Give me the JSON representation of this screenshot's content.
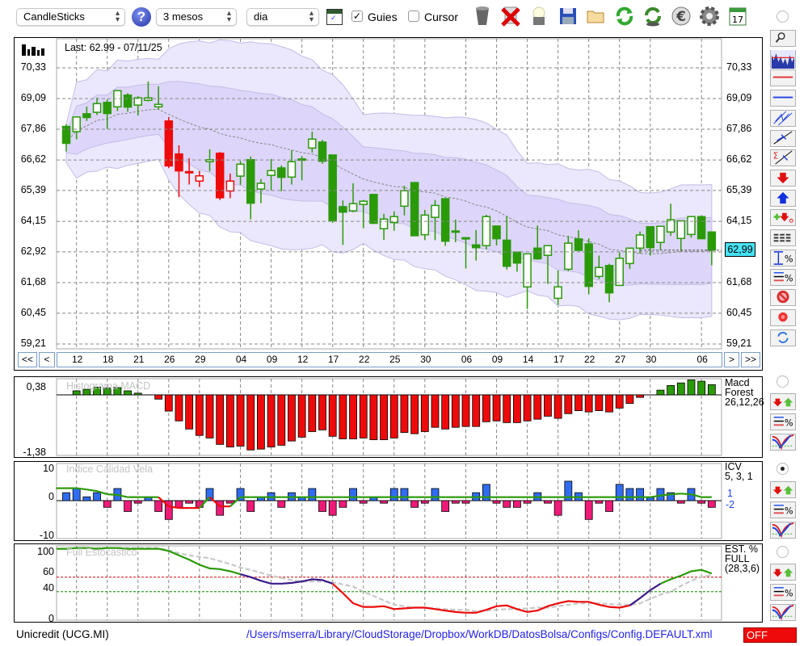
{
  "toolbar": {
    "chart_type": "CandleSticks",
    "period": "3 mesos",
    "interval": "dia",
    "guides_label": "Guies",
    "guides_checked": true,
    "cursor_label": "Cursor",
    "cursor_checked": false,
    "check_mark": "✓",
    "icons": [
      "trash-icon",
      "delete-icon",
      "lamp-icon",
      "save-icon",
      "folder-icon",
      "refresh-icon",
      "dollar-refresh-icon",
      "euro-icon",
      "gear-icon",
      "calendar-icon"
    ],
    "calendar_day": "17"
  },
  "main": {
    "last_text": "Last: 62.99 - 07/11/25",
    "price_label": "62,99",
    "last_price": 62.99,
    "y_ticks": [
      {
        "label": "70,33",
        "v": 70.33
      },
      {
        "label": "69,09",
        "v": 69.09
      },
      {
        "label": "67,86",
        "v": 67.86
      },
      {
        "label": "66,62",
        "v": 66.62
      },
      {
        "label": "65,39",
        "v": 65.39
      },
      {
        "label": "64,15",
        "v": 64.15
      },
      {
        "label": "62,92",
        "v": 62.92
      },
      {
        "label": "61,68",
        "v": 61.68
      },
      {
        "label": "60,45",
        "v": 60.45
      },
      {
        "label": "59,21",
        "v": 59.21
      }
    ],
    "ylim": [
      59.21,
      70.33
    ],
    "nav": {
      "first": "<<",
      "prev": "<",
      "next": ">",
      "last": ">>"
    },
    "dates": [
      {
        "label": "12",
        "i": 1
      },
      {
        "label": "18",
        "i": 4
      },
      {
        "label": "21",
        "i": 7
      },
      {
        "label": "26",
        "i": 10
      },
      {
        "label": "29",
        "i": 13
      },
      {
        "label": "04",
        "i": 17
      },
      {
        "label": "09",
        "i": 20
      },
      {
        "label": "12",
        "i": 23
      },
      {
        "label": "17",
        "i": 26
      },
      {
        "label": "22",
        "i": 29
      },
      {
        "label": "25",
        "i": 32
      },
      {
        "label": "30",
        "i": 35
      },
      {
        "label": "06",
        "i": 39
      },
      {
        "label": "09",
        "i": 42
      },
      {
        "label": "14",
        "i": 45
      },
      {
        "label": "17",
        "i": 48
      },
      {
        "label": "22",
        "i": 51
      },
      {
        "label": "27",
        "i": 54
      },
      {
        "label": "30",
        "i": 57
      },
      {
        "label": "06",
        "i": 62
      }
    ]
  },
  "candles": [
    [
      67.97,
      68.06,
      66.96,
      67.29,
      "g"
    ],
    [
      67.76,
      68.35,
      67.45,
      68.35,
      "g"
    ],
    [
      68.48,
      68.77,
      68.19,
      68.33,
      "g"
    ],
    [
      68.54,
      69.13,
      68.43,
      68.89,
      "g"
    ],
    [
      68.94,
      69.06,
      67.87,
      68.49,
      "g"
    ],
    [
      68.76,
      69.41,
      68.59,
      69.41,
      "g"
    ],
    [
      69.23,
      69.31,
      68.56,
      68.75,
      "g"
    ],
    [
      68.83,
      69.19,
      68.41,
      69.12,
      "g"
    ],
    [
      69.02,
      69.78,
      68.98,
      69.12,
      "g"
    ],
    [
      68.76,
      69.59,
      68.65,
      68.86,
      "g"
    ],
    [
      68.19,
      68.35,
      66.29,
      66.38,
      "r"
    ],
    [
      66.86,
      67.21,
      65.12,
      66.18,
      "r"
    ],
    [
      66.15,
      66.69,
      65.63,
      66.13,
      "r"
    ],
    [
      65.77,
      66.18,
      65.53,
      65.98,
      "r"
    ],
    [
      66.55,
      67.05,
      66.16,
      66.63,
      "g"
    ],
    [
      66.89,
      66.94,
      65.01,
      65.1,
      "r"
    ],
    [
      65.37,
      66.07,
      65.08,
      65.77,
      "r"
    ],
    [
      65.97,
      66.58,
      65.62,
      66.45,
      "g"
    ],
    [
      66.63,
      66.76,
      64.23,
      64.88,
      "g"
    ],
    [
      65.45,
      65.85,
      64.88,
      65.68,
      "g"
    ],
    [
      66.0,
      66.66,
      65.4,
      66.19,
      "g"
    ],
    [
      66.3,
      66.4,
      65.36,
      65.92,
      "g"
    ],
    [
      65.93,
      67.01,
      65.63,
      66.55,
      "g"
    ],
    [
      66.65,
      66.78,
      65.8,
      66.66,
      "g"
    ],
    [
      67.1,
      67.76,
      66.92,
      67.46,
      "g"
    ],
    [
      67.34,
      67.43,
      66.47,
      66.57,
      "g"
    ],
    [
      66.82,
      66.82,
      64.09,
      64.18,
      "g"
    ],
    [
      64.74,
      64.99,
      63.2,
      64.52,
      "g"
    ],
    [
      64.57,
      65.68,
      64.52,
      64.86,
      "g"
    ],
    [
      64.83,
      65.01,
      63.87,
      64.96,
      "g"
    ],
    [
      65.23,
      65.26,
      64.04,
      64.07,
      "g"
    ],
    [
      63.85,
      64.45,
      63.4,
      64.24,
      "g"
    ],
    [
      64.1,
      64.55,
      63.77,
      64.34,
      "g"
    ],
    [
      64.76,
      65.58,
      64.39,
      65.38,
      "g"
    ],
    [
      65.71,
      65.71,
      63.57,
      63.57,
      "g"
    ],
    [
      63.61,
      64.61,
      63.39,
      64.4,
      "g"
    ],
    [
      64.31,
      65.01,
      63.39,
      64.79,
      "g"
    ],
    [
      65.06,
      65.06,
      63.16,
      63.35,
      "g"
    ],
    [
      63.76,
      64.22,
      63.31,
      63.74,
      "g"
    ],
    [
      63.49,
      63.49,
      62.25,
      63.45,
      "g"
    ],
    [
      63.2,
      63.8,
      62.57,
      63.09,
      "g"
    ],
    [
      63.17,
      64.41,
      63.02,
      64.34,
      "g"
    ],
    [
      63.96,
      63.96,
      63.18,
      63.45,
      "g"
    ],
    [
      63.39,
      64.36,
      62.21,
      62.34,
      "g"
    ],
    [
      62.91,
      62.91,
      62.12,
      62.47,
      "g"
    ],
    [
      61.51,
      62.84,
      60.62,
      62.84,
      "g"
    ],
    [
      63.07,
      63.98,
      62.6,
      62.64,
      "g"
    ],
    [
      62.78,
      63.17,
      61.63,
      63.17,
      "g"
    ],
    [
      61.05,
      62.17,
      60.78,
      61.51,
      "g"
    ],
    [
      62.22,
      63.57,
      62.15,
      63.27,
      "g"
    ],
    [
      63.44,
      63.79,
      62.96,
      62.98,
      "g"
    ],
    [
      63.24,
      63.46,
      61.21,
      61.53,
      "g"
    ],
    [
      61.93,
      62.77,
      61.82,
      62.29,
      "g"
    ],
    [
      62.37,
      62.44,
      60.89,
      61.27,
      "g"
    ],
    [
      61.57,
      62.9,
      61.57,
      62.66,
      "g"
    ],
    [
      62.45,
      63.07,
      62.23,
      63.07,
      "g"
    ],
    [
      63.07,
      63.74,
      62.85,
      63.6,
      "g"
    ],
    [
      63.93,
      63.93,
      62.77,
      63.09,
      "g"
    ],
    [
      63.3,
      63.95,
      63.0,
      63.95,
      "g"
    ],
    [
      63.72,
      64.86,
      63.56,
      64.21,
      "g"
    ],
    [
      63.46,
      64.17,
      62.95,
      64.17,
      "g"
    ],
    [
      63.62,
      64.34,
      63.49,
      64.34,
      "g"
    ],
    [
      64.34,
      64.39,
      63.45,
      63.45,
      "g"
    ],
    [
      63.72,
      63.74,
      62.38,
      62.99,
      "g"
    ]
  ],
  "colors": {
    "g": "#2a9a08",
    "r": "#ee0a0a",
    "blue": "#2f6cf0",
    "pink": "#ee1a78",
    "purple": "#3a1a8a",
    "band_outer": "#ebe7fc",
    "band_inner": "#ddd6fa",
    "band_stroke": "#c3bde6",
    "price_box": "#47e3f5",
    "off": "#ee0a0a"
  },
  "macd": {
    "title": "Histograma MACD",
    "name": "Macd",
    "sub": "Forest",
    "params": "26,12,26",
    "ticks": [
      {
        "label": "0,38",
        "v": 0.38
      },
      {
        "label": "-1,38",
        "v": -1.38
      }
    ],
    "values": [
      null,
      0.095,
      0.13,
      0.18,
      0.16,
      0.17,
      0.095,
      0.04,
      0,
      -0.1,
      -0.38,
      -0.61,
      -0.8,
      -0.95,
      -1.01,
      -1.16,
      -1.22,
      -1.2,
      -1.29,
      -1.27,
      -1.22,
      -1.18,
      -1.08,
      -0.99,
      -0.86,
      -0.82,
      -0.97,
      -1.03,
      -1.03,
      -1.01,
      -1.05,
      -1.05,
      -1.01,
      -0.88,
      -0.91,
      -0.86,
      -0.76,
      -0.8,
      -0.76,
      -0.74,
      -0.74,
      -0.63,
      -0.61,
      -0.65,
      -0.65,
      -0.61,
      -0.57,
      -0.5,
      -0.55,
      -0.44,
      -0.37,
      -0.4,
      -0.37,
      -0.4,
      -0.31,
      -0.2,
      -0.06,
      0,
      0.11,
      0.22,
      0.28,
      0.35,
      0.32,
      0.24
    ]
  },
  "icv": {
    "title": "Indice Calidad Vela",
    "name": "ICV",
    "params": "5, 3, 1",
    "val1": "1",
    "val2": "-2",
    "ticks": [
      {
        "label": "10",
        "v": 10
      },
      {
        "label": "0",
        "v": 0
      },
      {
        "label": "-10",
        "v": -10
      }
    ],
    "bars": [
      2.5,
      3.8,
      1.2,
      2.5,
      -2.1,
      3.8,
      -3.4,
      -0.8,
      1,
      -3.4,
      -5.9,
      -2.1,
      -0.8,
      -2.1,
      3.8,
      -4.6,
      -0.8,
      3.8,
      -3.4,
      1,
      2.5,
      -2.1,
      2.5,
      1,
      3.8,
      -3.4,
      -4.6,
      -2.1,
      3.8,
      -0.8,
      1,
      -0.8,
      3.8,
      3.8,
      -2.1,
      -0.8,
      3.8,
      -3.4,
      -0.8,
      -0.8,
      2.5,
      5.1,
      -0.8,
      -2.1,
      -2.1,
      -0.8,
      2.5,
      -0.8,
      -4.6,
      6.1,
      2.5,
      -5.9,
      -0.8,
      -3.4,
      5.1,
      3.8,
      3.8,
      1,
      3.8,
      2.5,
      -0.8,
      3.8,
      -0.8,
      -2.1
    ],
    "line": [
      3.9,
      3.9,
      3.5,
      3.0,
      2.0,
      1.8,
      1.1,
      1.1,
      1.1,
      1.1,
      -1.8,
      -2.3,
      -2.3,
      -2.3,
      1.1,
      -1.8,
      -1.8,
      1.1,
      1.1,
      1.1,
      1.1,
      1.1,
      1.1,
      1.1,
      1.1,
      1.1,
      1.1,
      1.1,
      1.1,
      1.1,
      1.1,
      1.1,
      1.1,
      1.1,
      1.1,
      1.1,
      1.1,
      1.1,
      1.1,
      1.1,
      1.1,
      1.1,
      1.1,
      1.1,
      1.1,
      1.1,
      1.1,
      1.1,
      1.1,
      1.1,
      1.1,
      1.1,
      1.1,
      1.1,
      1.1,
      1.1,
      1.1,
      1.1,
      1.6,
      2.0,
      2.2,
      2.0,
      1.1,
      1.1
    ],
    "line_colors": "gggggggggg rrrr g rr g"
  },
  "stoch": {
    "title": "Full Estocastico",
    "name": "EST. %",
    "sub": "FULL",
    "params": "(28,3,6)",
    "ticks": [
      {
        "label": "100",
        "v": 100
      },
      {
        "label": "60",
        "v": 60
      },
      {
        "label": "40",
        "v": 40
      },
      {
        "label": "0",
        "v": 0
      }
    ],
    "upper": 60,
    "lower": 40,
    "k": [
      99,
      100,
      100,
      99,
      100,
      100,
      99,
      99,
      99,
      99,
      96,
      90,
      84,
      77,
      72,
      71,
      68,
      64,
      60,
      55,
      51,
      51,
      52,
      54,
      57,
      56,
      51,
      38,
      24,
      19,
      19,
      20,
      16,
      17,
      18,
      18,
      16,
      14,
      12,
      11,
      11,
      15,
      20,
      21,
      16,
      12,
      14,
      20,
      24,
      27,
      26,
      26,
      22,
      19,
      18,
      21,
      31,
      42,
      51,
      57,
      62,
      68,
      70,
      65
    ],
    "d": [
      99,
      100,
      100,
      100,
      100,
      100,
      100,
      100,
      100,
      100,
      97,
      93,
      90,
      88,
      86,
      82,
      78,
      73,
      70,
      66,
      62,
      59,
      56,
      54,
      54,
      54,
      53,
      50,
      47,
      40,
      34,
      28,
      22,
      20,
      18,
      18,
      17,
      16,
      15,
      15,
      13,
      14,
      15,
      16,
      16,
      17,
      18,
      18,
      20,
      22,
      24,
      24,
      24,
      23,
      22,
      22,
      24,
      30,
      36,
      40,
      48,
      55,
      60,
      63
    ],
    "segments": [
      {
        "from": 0,
        "to": 17,
        "c": "g"
      },
      {
        "from": 17,
        "to": 26,
        "c": "purple"
      },
      {
        "from": 26,
        "to": 55,
        "c": "r"
      },
      {
        "from": 55,
        "to": 58,
        "c": "purple"
      },
      {
        "from": 58,
        "to": 63,
        "c": "g"
      }
    ]
  },
  "status": {
    "symbol": "Unicredit (UCG.MI)",
    "path": "/Users/mserra/Library/CloudStorage/Dropbox/WorkDB/DatosBolsa/Configs/Config.DEFAULT.xml",
    "off": "OFF"
  }
}
